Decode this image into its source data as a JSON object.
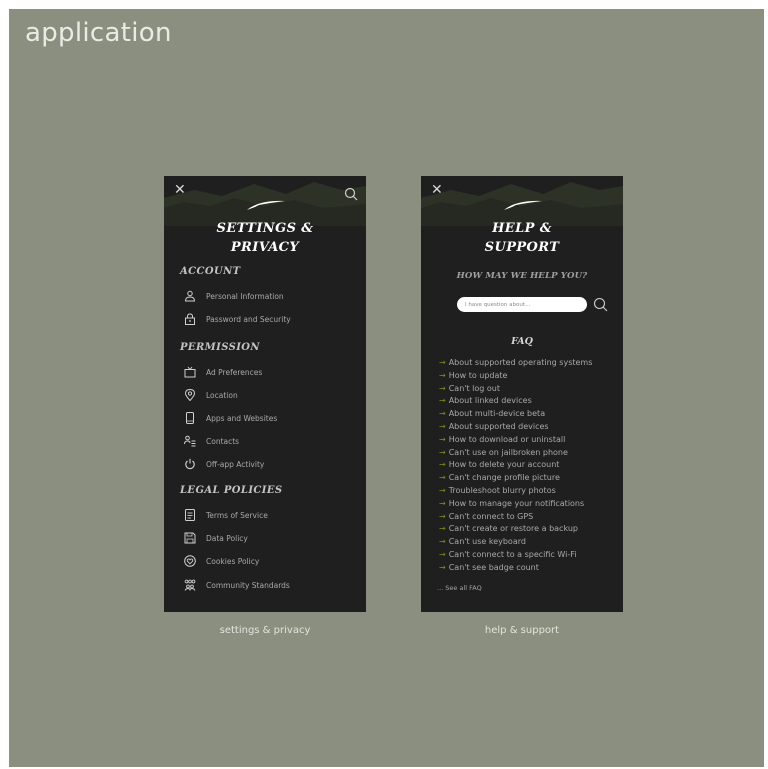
{
  "page": {
    "title": "application"
  },
  "colors": {
    "background": "#8a8f80",
    "panel": "#1f1f1f",
    "mountain": "#2c3226",
    "accent_arrow": "#7a9120"
  },
  "settings_screen": {
    "title_line1": "SETTINGS &",
    "title_line2": "PRIVACY",
    "icons": {
      "close": "close-icon",
      "search": "search-icon",
      "logo": "feather-logo"
    },
    "sections": [
      {
        "heading": "ACCOUNT",
        "items": [
          {
            "label": "Personal Information",
            "icon": "person-icon"
          },
          {
            "label": "Password and Security",
            "icon": "lock-icon"
          }
        ]
      },
      {
        "heading": "PERMISSION",
        "items": [
          {
            "label": "Ad Preferences",
            "icon": "tv-icon"
          },
          {
            "label": "Location",
            "icon": "location-pin-icon"
          },
          {
            "label": "Apps and Websites",
            "icon": "phone-icon"
          },
          {
            "label": "Contacts",
            "icon": "contacts-icon"
          },
          {
            "label": "Off-app Activity",
            "icon": "power-icon"
          }
        ]
      },
      {
        "heading": "LEGAL POLICIES",
        "items": [
          {
            "label": "Terms of Service",
            "icon": "document-icon"
          },
          {
            "label": "Data Policy",
            "icon": "floppy-disk-icon"
          },
          {
            "label": "Cookies Policy",
            "icon": "cookie-heart-icon"
          },
          {
            "label": "Community Standards",
            "icon": "community-icon"
          }
        ]
      }
    ],
    "caption": "settings & privacy"
  },
  "help_screen": {
    "title_line1": "HELP &",
    "title_line2": "SUPPORT",
    "question": "HOW MAY WE HELP YOU?",
    "search_placeholder": "I have question about...",
    "faq_title": "FAQ",
    "faq_items": [
      "About supported operating systems",
      "How to update",
      "Can't log out",
      "About linked devices",
      "About multi-device beta",
      "About supported devices",
      "How to download or uninstall",
      "Can't use on jailbroken phone",
      "How to delete your account",
      "Can't change profile picture",
      "Troubleshoot blurry photos",
      "How to manage your notifications",
      "Can't connect to GPS",
      "Can't create or restore a backup",
      "Can't use keyboard",
      "Can't connect to a specific Wi-Fi",
      "Can't see badge count"
    ],
    "see_all": "... See all FAQ",
    "caption": "help & support"
  }
}
